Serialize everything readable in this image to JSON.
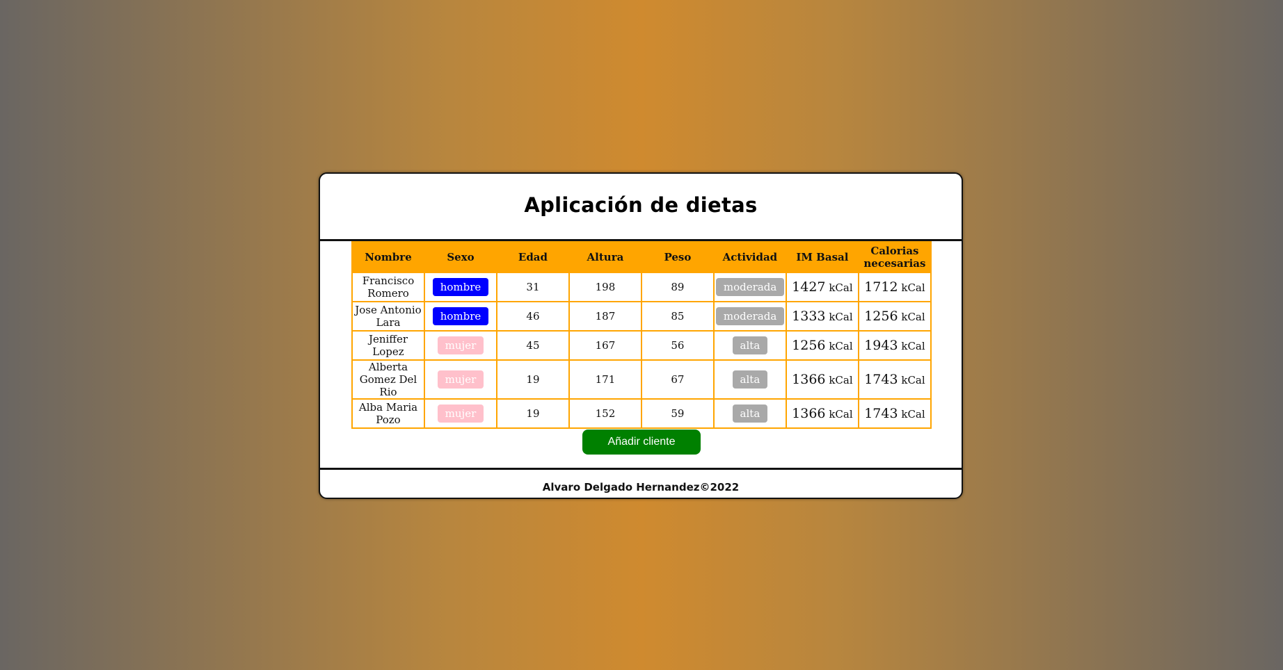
{
  "app": {
    "title": "Aplicación de dietas",
    "footer": "Alvaro Delgado Hernandez©2022",
    "add_button_label": "Añadir cliente"
  },
  "table": {
    "headers": [
      "Nombre",
      "Sexo",
      "Edad",
      "Altura",
      "Peso",
      "Actividad",
      "IM Basal",
      "Calorias necesarias"
    ],
    "unit": "kCal",
    "rows": [
      {
        "nombre": "Francisco Romero",
        "sexo": "hombre",
        "edad": "31",
        "altura": "198",
        "peso": "89",
        "actividad": "moderada",
        "basal": "1427",
        "calorias": "1712"
      },
      {
        "nombre": "Jose Antonio Lara",
        "sexo": "hombre",
        "edad": "46",
        "altura": "187",
        "peso": "85",
        "actividad": "moderada",
        "basal": "1333",
        "calorias": "1256"
      },
      {
        "nombre": "Jeniffer Lopez",
        "sexo": "mujer",
        "edad": "45",
        "altura": "167",
        "peso": "56",
        "actividad": "alta",
        "basal": "1256",
        "calorias": "1943"
      },
      {
        "nombre": "Alberta Gomez Del Rio",
        "sexo": "mujer",
        "edad": "19",
        "altura": "171",
        "peso": "67",
        "actividad": "alta",
        "basal": "1366",
        "calorias": "1743"
      },
      {
        "nombre": "Alba Maria Pozo",
        "sexo": "mujer",
        "edad": "19",
        "altura": "152",
        "peso": "59",
        "actividad": "alta",
        "basal": "1366",
        "calorias": "1743"
      }
    ]
  },
  "colors": {
    "header": "#ffa500",
    "hombre": "#0000ff",
    "mujer": "#ffc0cb",
    "actividad": "#a9a9a9",
    "button": "#008000"
  }
}
